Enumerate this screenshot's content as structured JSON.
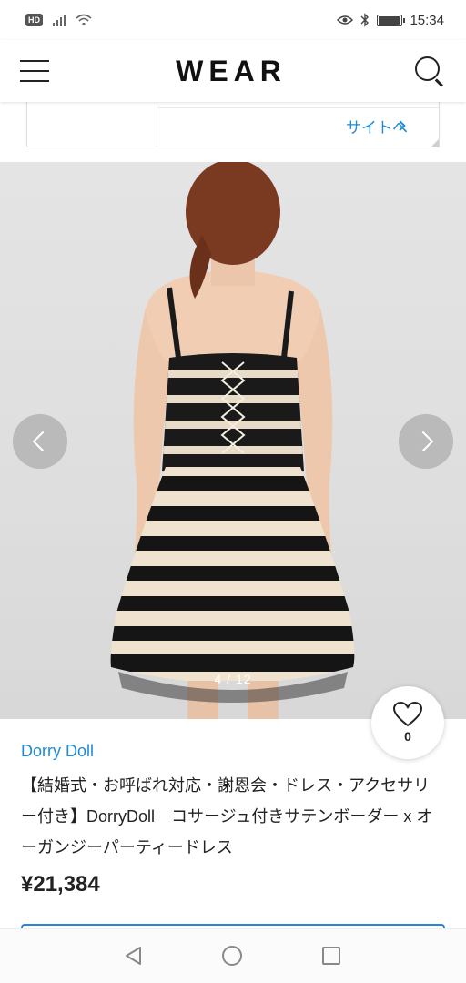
{
  "status_bar": {
    "network_badge": "HD",
    "time": "15:34",
    "battery_level": 0.85
  },
  "header": {
    "logo": "WEAR"
  },
  "ad": {
    "link_label": "サイトへ"
  },
  "gallery": {
    "counter": "4 / 12",
    "current": 4,
    "total": 12
  },
  "product": {
    "likes": "0",
    "brand": "Dorry Doll",
    "title": "【結婚式・お呼ばれ対応・謝恩会・ドレス・アクセサリー付き】DorryDoll　コサージュ付きサテンボーダー x オーガンジーパーティードレス",
    "price": "¥21,384"
  },
  "icons": {
    "menu": "hamburger-icon",
    "search": "search-icon",
    "like": "heart-icon",
    "prev": "chevron-left-icon",
    "next": "chevron-right-icon",
    "ad_arrow": "chevron-right-icon",
    "nav_back": "triangle-back-icon",
    "nav_home": "circle-home-icon",
    "nav_recent": "square-recent-icon"
  },
  "colors": {
    "accent": "#1f8ad6",
    "ad_logo": "#f4a21c"
  }
}
